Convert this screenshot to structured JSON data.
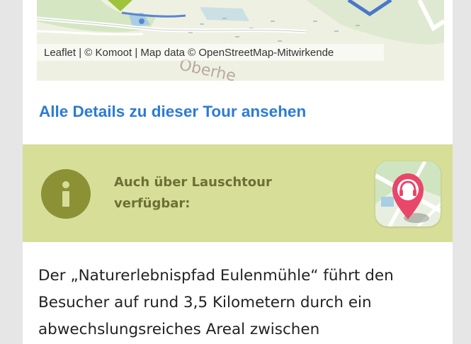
{
  "map": {
    "attribution_text": "Leaflet | © Komoot | Map data © OpenStreetMap-Mitwirkende",
    "place_label": "Oberhe"
  },
  "tour_link": {
    "label": "Alle Details zu dieser Tour ansehen"
  },
  "info_band": {
    "icon": "info-icon",
    "text": "Auch über Lauschtour verfügbar:",
    "app_icon": "lauschtour-app-icon"
  },
  "description": {
    "text": "Der „Naturerlebnispfad Eulenmühle“ führt den Besucher auf rund 3,5 Kilometern durch ein abwechslungsreiches Areal zwischen"
  },
  "colors": {
    "link": "#2b7bd6",
    "band": "#d6de97",
    "info_icon": "#8c9136",
    "info_text": "#6d7035",
    "app_pin": "#e8476a"
  }
}
